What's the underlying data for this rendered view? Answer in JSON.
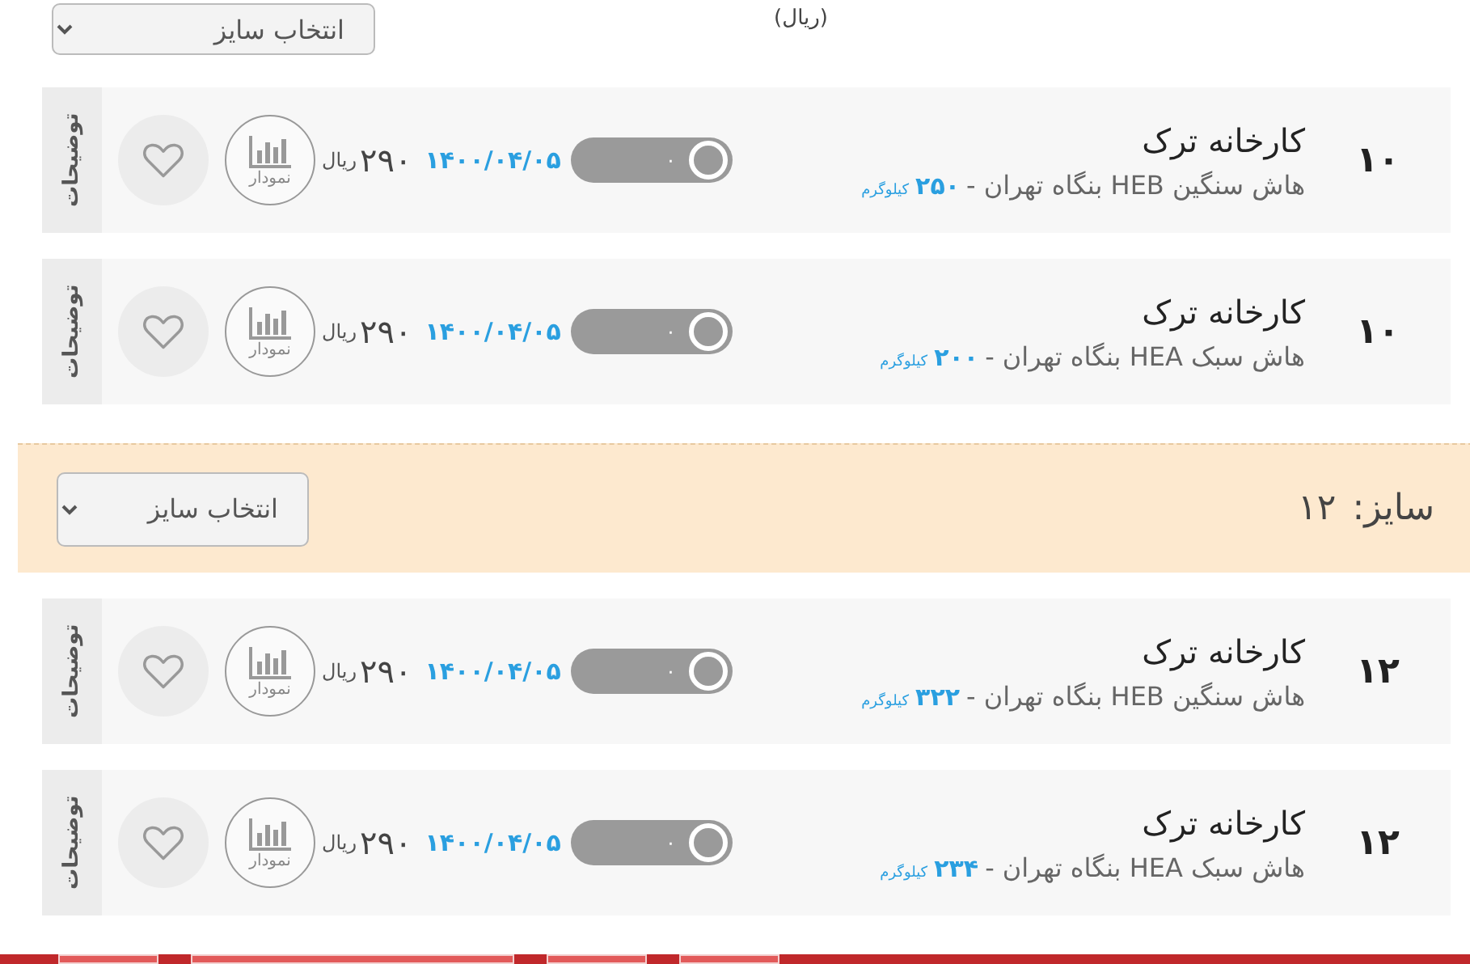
{
  "top": {
    "size_select": "انتخاب سایز",
    "unit": "(ریال)"
  },
  "sections": [
    {
      "kind": "product",
      "size": "۱۰",
      "seller": "کارخانه ترک",
      "description": "هاش سنگین HEB بنگاه تهران -",
      "weight": "۲۵۰",
      "weight_unit": "کیلوگرم",
      "switch_label": "۰",
      "switch_on": false,
      "date": "۱۴۰۰/۰۴/۰۵",
      "price": "۲۹۰",
      "currency": "ریال",
      "chart_label": "نمودار",
      "notes_tab": "توضیحات"
    },
    {
      "kind": "product",
      "size": "۱۰",
      "seller": "کارخانه ترک",
      "description": "هاش سبک HEA بنگاه تهران -",
      "weight": "۲۰۰",
      "weight_unit": "کیلوگرم",
      "switch_label": "۰",
      "switch_on": false,
      "date": "۱۴۰۰/۰۴/۰۵",
      "price": "۲۹۰",
      "currency": "ریال",
      "chart_label": "نمودار",
      "notes_tab": "توضیحات"
    },
    {
      "kind": "size_header",
      "label": "سایز:",
      "value": "۱۲",
      "select": "انتخاب سایز"
    },
    {
      "kind": "product",
      "size": "۱۲",
      "seller": "کارخانه ترک",
      "description": "هاش سنگین HEB بنگاه تهران -",
      "weight": "۳۲۲",
      "weight_unit": "کیلوگرم",
      "switch_label": "۰",
      "switch_on": false,
      "date": "۱۴۰۰/۰۴/۰۵",
      "price": "۲۹۰",
      "currency": "ریال",
      "chart_label": "نمودار",
      "notes_tab": "توضیحات"
    },
    {
      "kind": "product",
      "size": "۱۲",
      "seller": "کارخانه ترک",
      "description": "هاش سبک HEA بنگاه تهران -",
      "weight": "۲۳۴",
      "weight_unit": "کیلوگرم",
      "switch_label": "۰",
      "switch_on": false,
      "date": "۱۴۰۰/۰۴/۰۵",
      "price": "۲۹۰",
      "currency": "ریال",
      "chart_label": "نمودار",
      "notes_tab": "توضیحات"
    }
  ]
}
